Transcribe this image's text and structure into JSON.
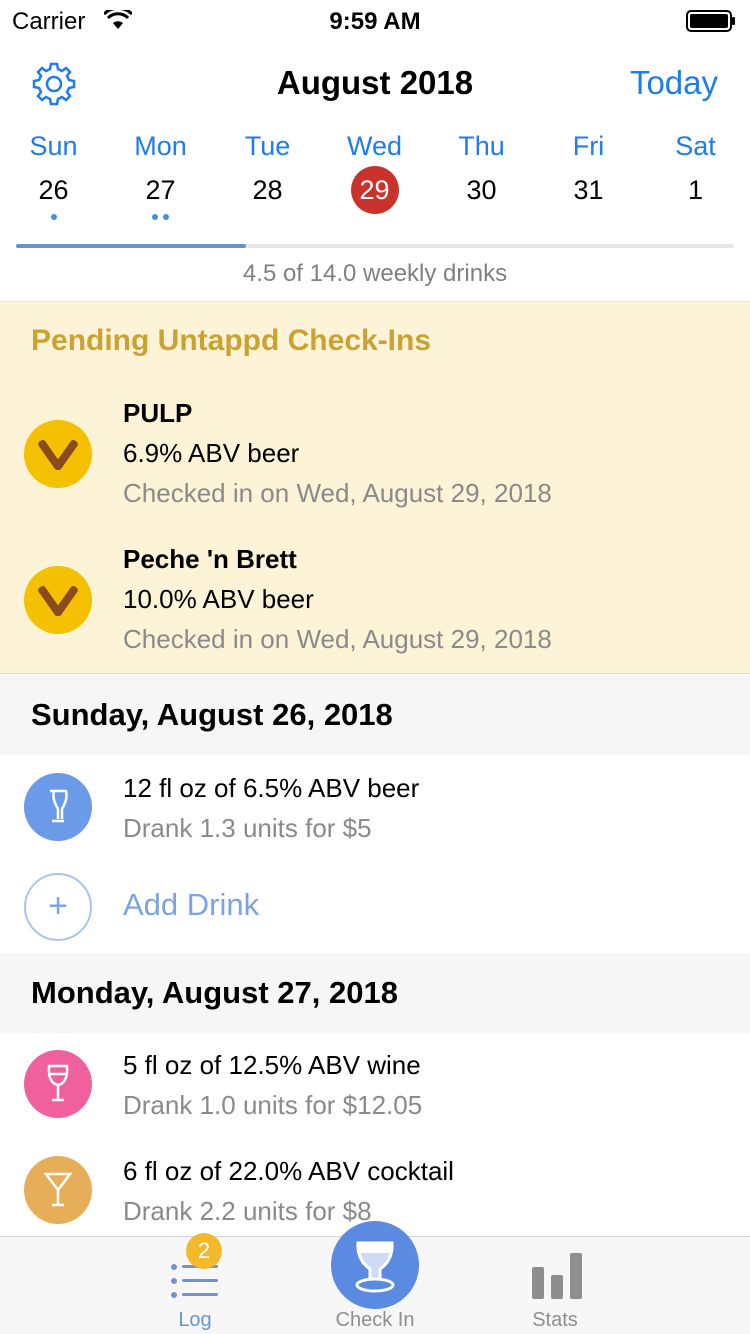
{
  "status_bar": {
    "carrier": "Carrier",
    "time": "9:59 AM"
  },
  "header": {
    "month": "August 2018",
    "today_label": "Today",
    "days": [
      {
        "name": "Sun",
        "num": "26",
        "dots": 1,
        "selected": false
      },
      {
        "name": "Mon",
        "num": "27",
        "dots": 2,
        "selected": false
      },
      {
        "name": "Tue",
        "num": "28",
        "dots": 0,
        "selected": false
      },
      {
        "name": "Wed",
        "num": "29",
        "dots": 0,
        "selected": true
      },
      {
        "name": "Thu",
        "num": "30",
        "dots": 0,
        "selected": false
      },
      {
        "name": "Fri",
        "num": "31",
        "dots": 0,
        "selected": false
      },
      {
        "name": "Sat",
        "num": "1",
        "dots": 0,
        "selected": false
      }
    ],
    "weekly_progress": 0.32,
    "weekly_text": "4.5 of 14.0 weekly drinks"
  },
  "pending": {
    "title": "Pending Untappd Check-Ins",
    "items": [
      {
        "name": "PULP",
        "abv": "6.9% ABV beer",
        "date": "Checked in on Wed, August 29, 2018"
      },
      {
        "name": "Peche 'n Brett",
        "abv": "10.0% ABV beer",
        "date": "Checked in on Wed, August 29, 2018"
      }
    ]
  },
  "sections": [
    {
      "title": "Sunday, August 26, 2018",
      "entries": [
        {
          "main": "12 fl oz of 6.5% ABV beer",
          "sub": "Drank 1.3 units for $5",
          "icon": "beer-glass-icon",
          "color": "#6b9be8"
        }
      ],
      "add_label": "Add Drink"
    },
    {
      "title": "Monday, August 27, 2018",
      "entries": [
        {
          "main": "5 fl oz of 12.5% ABV wine",
          "sub": "Drank 1.0 units for $12.05",
          "icon": "wine-glass-icon",
          "color": "#f0609c"
        },
        {
          "main": "6 fl oz of 22.0% ABV cocktail",
          "sub": "Drank 2.2 units for $8",
          "icon": "cocktail-glass-icon",
          "color": "#e7ae5a"
        }
      ]
    }
  ],
  "tabbar": {
    "log_label": "Log",
    "log_badge": "2",
    "checkin_label": "Check In",
    "stats_label": "Stats"
  },
  "colors": {
    "accent": "#1e7bf2",
    "selected_day": "#c8332c",
    "pending_bg": "#fdf3d6",
    "pending_title": "#cba232"
  }
}
